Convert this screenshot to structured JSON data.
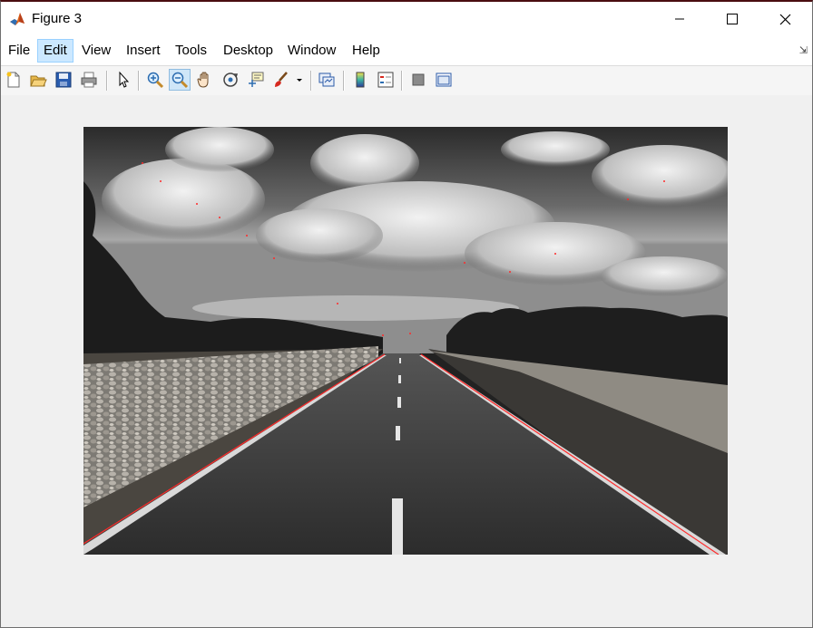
{
  "window": {
    "title": "Figure 3"
  },
  "menu": {
    "items": [
      {
        "label": "File"
      },
      {
        "label": "Edit"
      },
      {
        "label": "View"
      },
      {
        "label": "Insert"
      },
      {
        "label": "Tools"
      },
      {
        "label": "Desktop"
      },
      {
        "label": "Window"
      },
      {
        "label": "Help"
      }
    ],
    "active": "Edit"
  },
  "toolbar": {
    "buttons": [
      {
        "icon": "new-figure-icon"
      },
      {
        "icon": "open-file-icon"
      },
      {
        "icon": "save-icon"
      },
      {
        "icon": "print-icon"
      },
      {
        "icon": "pointer-icon"
      },
      {
        "icon": "zoom-in-icon"
      },
      {
        "icon": "zoom-out-icon",
        "pressed": true
      },
      {
        "icon": "pan-icon"
      },
      {
        "icon": "rotate-3d-icon"
      },
      {
        "icon": "data-cursor-icon"
      },
      {
        "icon": "brush-icon"
      },
      {
        "icon": "link-plot-icon"
      },
      {
        "icon": "colorbar-icon"
      },
      {
        "icon": "legend-icon"
      },
      {
        "icon": "hide-plot-tools-icon"
      },
      {
        "icon": "show-plot-tools-icon"
      }
    ]
  },
  "figure": {
    "image_description_colors": {
      "edge_color": "#ff2a2a",
      "road": "#2e2e2e",
      "sky": "#8a8a8a"
    }
  }
}
